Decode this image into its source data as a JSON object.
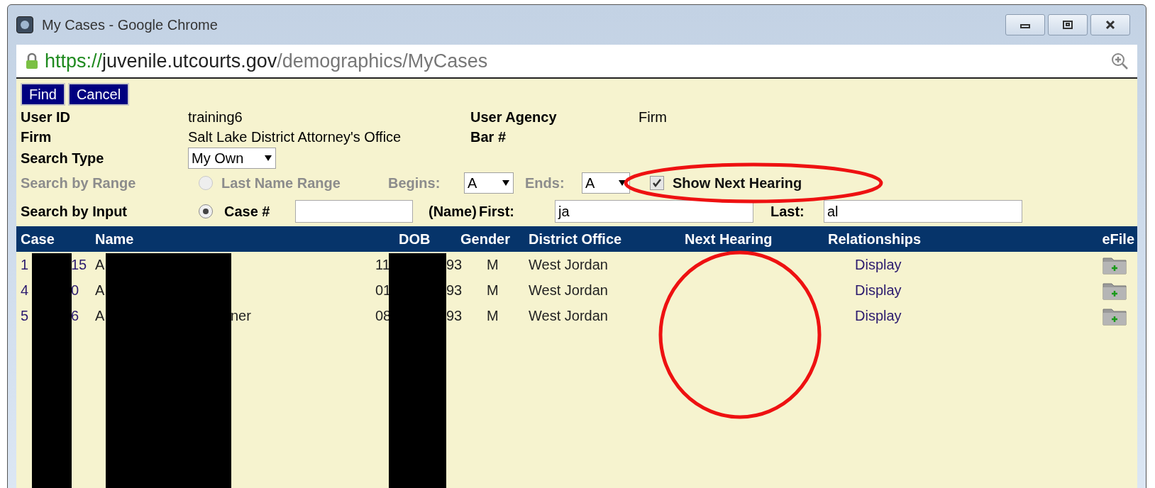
{
  "window": {
    "title": "My Cases - Google Chrome"
  },
  "address_bar": {
    "scheme": "https://",
    "host": "juvenile.utcourts.gov",
    "path": "/demographics/MyCases"
  },
  "toolbar": {
    "buttons": [
      "Find",
      "Cancel"
    ]
  },
  "info": [
    {
      "label": "User ID",
      "value": "training6",
      "label_2": "User Agency",
      "value_2": "Firm"
    },
    {
      "label": "Firm",
      "value": "Salt Lake District Attorney's Office",
      "label_2": "Bar #"
    }
  ],
  "search_type": {
    "label": "Search Type",
    "value": "My Own"
  },
  "search_by_range": {
    "label": "Search by Range",
    "disabled": true,
    "selected": false,
    "option": "Last Name Range",
    "begins_label": "Begins:",
    "begins": "A",
    "ends_label": "Ends:",
    "ends": "A"
  },
  "show_next_hearing": {
    "label": "Show Next Hearing",
    "checked": true
  },
  "search_by_input": {
    "label": "Search by Input",
    "selected": true,
    "option": "Case #",
    "name_label": "(Name)",
    "first_label": "First:",
    "first": "ja",
    "last_label": "Last:",
    "last": "al"
  },
  "table": {
    "columns": [
      "Case",
      "Name",
      "DOB",
      "Gender",
      "District Office",
      "Next Hearing",
      "Relationships",
      "eFile"
    ],
    "rows": [
      {
        "case": [
          "1",
          "15"
        ],
        "name": [
          "A"
        ],
        "dob": [
          "11",
          "93"
        ],
        "gender": "M",
        "district_office": "West Jordan",
        "relationships": "Display"
      },
      {
        "case": [
          "4",
          "0"
        ],
        "name": [
          "A"
        ],
        "dob": [
          "01",
          "93"
        ],
        "gender": "M",
        "district_office": "West Jordan",
        "relationships": "Display"
      },
      {
        "case": [
          "5",
          "6"
        ],
        "name": [
          "A",
          "ner"
        ],
        "dob": [
          "08",
          "93"
        ],
        "gender": "M",
        "district_office": "West Jordan",
        "relationships": "Display"
      }
    ]
  }
}
